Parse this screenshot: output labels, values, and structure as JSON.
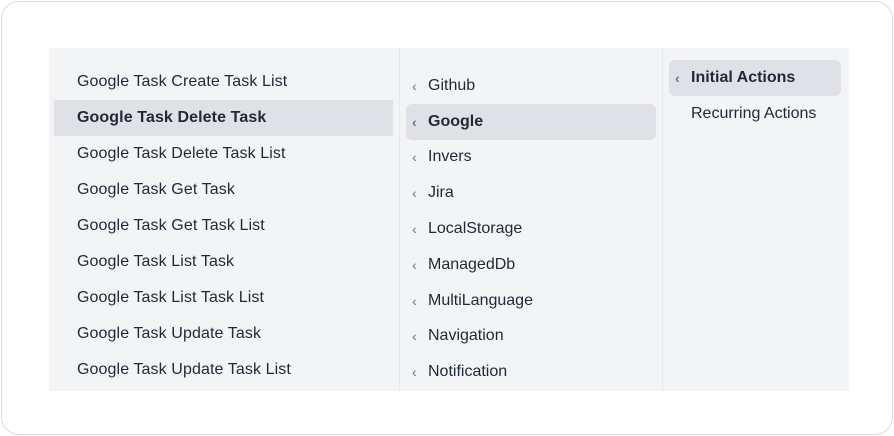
{
  "actions": [
    {
      "label": "Google Task Create Task List"
    },
    {
      "label": "Google Task Delete Task"
    },
    {
      "label": "Google Task Delete Task List"
    },
    {
      "label": "Google Task Get Task"
    },
    {
      "label": "Google Task Get Task List"
    },
    {
      "label": "Google Task List Task"
    },
    {
      "label": "Google Task List Task List"
    },
    {
      "label": "Google Task Update Task"
    },
    {
      "label": "Google Task Update Task List"
    }
  ],
  "selected_action": "Google Task Delete Task",
  "integrations": [
    {
      "label": "Github"
    },
    {
      "label": "Google"
    },
    {
      "label": "Invers"
    },
    {
      "label": "Jira"
    },
    {
      "label": "LocalStorage"
    },
    {
      "label": "ManagedDb"
    },
    {
      "label": "MultiLanguage"
    },
    {
      "label": "Navigation"
    },
    {
      "label": "Notification"
    }
  ],
  "selected_integration": "Google",
  "action_types": [
    {
      "label": "Initial Actions",
      "has_chevron": true
    },
    {
      "label": "Recurring Actions",
      "has_chevron": false
    }
  ],
  "selected_action_type": "Initial Actions",
  "chevron_icon": "chevron-left-icon",
  "colors": {
    "menu_bg": "#f3f4f6",
    "selected_bg": "#e0e1e6",
    "text": "#1f2937",
    "chevron": "#6b7280"
  }
}
